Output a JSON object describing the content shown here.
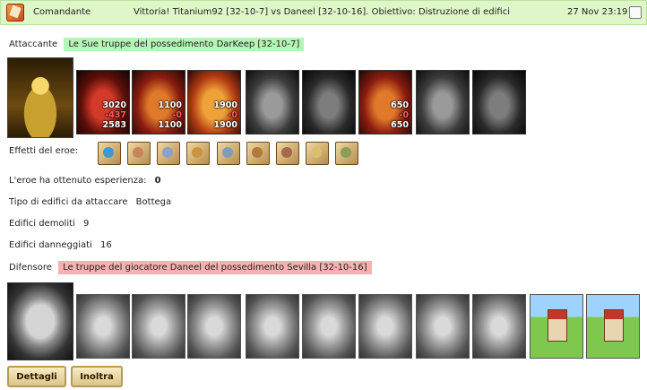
{
  "header": {
    "sender": "Comandante",
    "subject": "Vittoria! Titanium92 [32-10-7] vs Daneel [32-10-16]. Obiettivo: Distruzione di edifici",
    "date": "27 Nov 23:19"
  },
  "attacker": {
    "label": "Attaccante",
    "name": "Le Sue truppe del possedimento DarKeep [32-10-7]",
    "units": [
      {
        "icon": "red-demon-unit",
        "stats": [
          "3020",
          "-437",
          "2583"
        ]
      },
      {
        "icon": "fire-warrior-unit",
        "stats": [
          "1100",
          "-0",
          "1100"
        ]
      },
      {
        "icon": "fire-hound-unit",
        "stats": [
          "1900",
          "-0",
          "1900"
        ]
      },
      {
        "icon": "gray-beast-unit",
        "stats": []
      },
      {
        "icon": "gray-golem-unit",
        "stats": []
      },
      {
        "icon": "fire-giant-unit",
        "stats": [
          "650",
          "-0",
          "650"
        ]
      },
      {
        "icon": "gray-knight-unit",
        "stats": []
      },
      {
        "icon": "gray-wraith-unit",
        "stats": []
      }
    ]
  },
  "hero_effects": {
    "label": "Effetti del eroe:",
    "icons": [
      "sword-icon",
      "handshake-icon",
      "gauntlet-icon",
      "scroll-icon",
      "helmet-icon",
      "horned-helm-icon",
      "armor-icon",
      "ring-icon",
      "spear-icon"
    ]
  },
  "experience": {
    "label": "L'eroe ha ottenuto esperienza:",
    "value": "0"
  },
  "building_type": {
    "label": "Tipo di edifici da attaccare",
    "value": "Bottega"
  },
  "demolished": {
    "label": "Edifici demoliti",
    "value": "9"
  },
  "damaged": {
    "label": "Edifici danneggiati",
    "value": "16"
  },
  "defender": {
    "label": "Difensore",
    "name": "Le truppe del giocatore Daneel del possedimento Sevilla [32-10-16]",
    "units": [
      "knight-unit",
      "swordsman-unit",
      "horseman-unit",
      "griffin-rider-unit",
      "archer-unit",
      "monk-unit",
      "paladin-unit",
      "crusader-unit",
      "tower-unit",
      "tower-unit"
    ]
  },
  "buttons": {
    "details": "Dettagli",
    "forward": "Inoltra"
  },
  "colors": {
    "header_bg": "#dff7c8",
    "attacker_tag": "#b5f5b5",
    "defender_tag": "#f7b1b1",
    "button_bg": "#f0deaa"
  }
}
